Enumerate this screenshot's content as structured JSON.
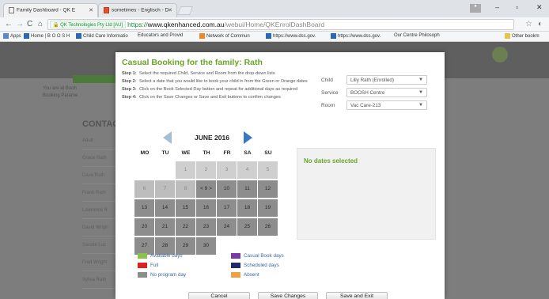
{
  "browser": {
    "tabs": [
      {
        "label": "Family Dashboard - QK E"
      },
      {
        "label": "sometimes - Englisch - D"
      }
    ],
    "url": {
      "secure_label": "QK Technologies Pty Ltd [AU]",
      "scheme": "https://",
      "host": "www.qkenhanced.com.au",
      "path": "/webui/Home/QKEnrolDashBoard"
    },
    "bookmarks": [
      {
        "label": "Apps",
        "icon": "apps-grid-icon"
      },
      {
        "label": "Home | B O O S H",
        "icon": "site-icon"
      },
      {
        "label": "Child Care Informatio",
        "icon": "site-icon"
      },
      {
        "label": "Educators and Provid",
        "icon": "page-icon"
      },
      {
        "label": "Network of Commun",
        "icon": "site-icon"
      },
      {
        "label": "https://www.dss.gov.",
        "icon": "site-icon"
      },
      {
        "label": "https://www.dss.gov.",
        "icon": "site-icon"
      },
      {
        "label": "Our Centre Philosoph",
        "icon": "page-icon"
      },
      {
        "label": "Other bookm",
        "icon": "folder-icon"
      }
    ]
  },
  "background_page": {
    "contacts_heading": "CONTAC",
    "left_text": [
      "You are at Booh",
      "Booking Parame"
    ],
    "list_label": "Full Name",
    "rows": [
      "Adult",
      "Grace Rath",
      "Dave Rath",
      "Frank Rath",
      "Lawrence R",
      "David Wrigh",
      "Sandie Luc",
      "Fred Wright",
      "Sylvia Rath",
      "Lilly Rath"
    ],
    "right_header": "Options",
    "right_rows": [
      "Edit",
      "Edit",
      "Edit",
      "Edit",
      "Edit",
      "Edit",
      "Edit",
      "Edit",
      "Edit",
      "Edit"
    ]
  },
  "modal": {
    "title": "Casual Booking for the family: Rath",
    "steps": [
      {
        "num": "Step 1:",
        "text": "Select the required Child, Service and Room from the drop-down lists"
      },
      {
        "num": "Step 2:",
        "text": "Select a date that you would like to book your child in from the Green or Orange dates"
      },
      {
        "num": "Step 3:",
        "text": "Click on the Book Selected Day button and repeat for additional days as required"
      },
      {
        "num": "Step 4:",
        "text": "Click on the Save Changes or Save and Exit buttons to confirm changes"
      }
    ],
    "selectors": {
      "child": {
        "label": "Child",
        "value": "Lilly Rath (Enrolled)"
      },
      "service": {
        "label": "Service",
        "value": "BOOSH Centre"
      },
      "room": {
        "label": "Room",
        "value": "Vac Care-213"
      }
    },
    "calendar": {
      "month": "JUNE 2016",
      "days_of_week": [
        "MO",
        "TU",
        "WE",
        "TH",
        "FR",
        "SA",
        "SU"
      ],
      "weeks": [
        [
          "",
          "",
          "1",
          "2",
          "3",
          "4",
          "5"
        ],
        [
          "6",
          "7",
          "8",
          "< 9 >",
          "10",
          "11",
          "12"
        ],
        [
          "13",
          "14",
          "15",
          "16",
          "17",
          "18",
          "19"
        ],
        [
          "20",
          "21",
          "22",
          "23",
          "24",
          "25",
          "26"
        ],
        [
          "27",
          "28",
          "29",
          "30",
          "",
          "",
          ""
        ]
      ]
    },
    "selected_panel": {
      "text": "No dates selected"
    },
    "legend": [
      {
        "label": "Available days",
        "color": "#8bc34a"
      },
      {
        "label": "Casual Book days",
        "color": "#7b3aa3"
      },
      {
        "label": "Full",
        "color": "#e02020"
      },
      {
        "label": "Scheduled days",
        "color": "#1f2a6b"
      },
      {
        "label": "No program day",
        "color": "#8d8d8d"
      },
      {
        "label": "Absent",
        "color": "#f0a040"
      }
    ],
    "buttons": {
      "cancel": "Cancel",
      "save": "Save Changes",
      "save_exit": "Save and Exit"
    }
  }
}
